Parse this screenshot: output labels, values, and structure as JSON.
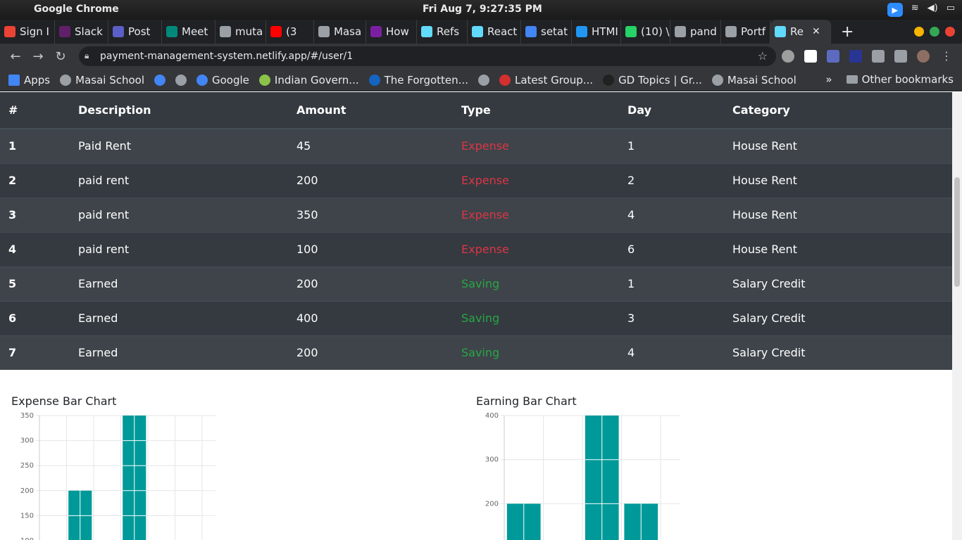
{
  "os_bar": {
    "app_name": "Google Chrome",
    "clock": "Fri Aug  7,  9:27:35 PM"
  },
  "tabs": [
    {
      "label": "Sign I",
      "color": "#ea4335"
    },
    {
      "label": "Slack",
      "color": "#611f69"
    },
    {
      "label": "Post",
      "color": "#5b5fc7"
    },
    {
      "label": "Meet",
      "color": "#00897b"
    },
    {
      "label": "muta",
      "color": "#9aa0a6"
    },
    {
      "label": "(3",
      "color": "#ff0000"
    },
    {
      "label": "Masa",
      "color": "#9aa0a6"
    },
    {
      "label": "How",
      "color": "#7b1fa2"
    },
    {
      "label": "Refs",
      "color": "#61dafb"
    },
    {
      "label": "React",
      "color": "#61dafb"
    },
    {
      "label": "setat",
      "color": "#4285f4"
    },
    {
      "label": "HTMI",
      "color": "#2196f3"
    },
    {
      "label": "(10) \\",
      "color": "#25d366"
    },
    {
      "label": "pand",
      "color": "#9aa0a6"
    },
    {
      "label": "Portf",
      "color": "#9aa0a6"
    },
    {
      "label": "Re",
      "color": "#61dafb",
      "active": true
    }
  ],
  "address_bar": {
    "url": "payment-management-system.netlify.app/#/user/1"
  },
  "bookmarks": [
    {
      "label": "Apps",
      "color": "#4285f4"
    },
    {
      "label": "Masai School",
      "color": "#9aa0a6"
    },
    {
      "label": "",
      "color": "#4285f4"
    },
    {
      "label": "",
      "color": "#9aa0a6"
    },
    {
      "label": "Google",
      "color": "#4285f4"
    },
    {
      "label": "Indian Govern...",
      "color": "#8bc34a"
    },
    {
      "label": "The Forgotten...",
      "color": "#1565c0"
    },
    {
      "label": "",
      "color": "#9aa0a6"
    },
    {
      "label": "Latest Group...",
      "color": "#d32f2f"
    },
    {
      "label": "GD Topics | Gr...",
      "color": "#212121"
    },
    {
      "label": "Masai School",
      "color": "#9aa0a6"
    }
  ],
  "bookmarks_more": "»",
  "other_bookmarks": "Other bookmarks",
  "table": {
    "headers": [
      "#",
      "Description",
      "Amount",
      "Type",
      "Day",
      "Category"
    ],
    "rows": [
      {
        "n": "1",
        "desc": "Paid Rent",
        "amount": "45",
        "type": "Expense",
        "day": "1",
        "category": "House Rent"
      },
      {
        "n": "2",
        "desc": "paid rent",
        "amount": "200",
        "type": "Expense",
        "day": "2",
        "category": "House Rent"
      },
      {
        "n": "3",
        "desc": "paid rent",
        "amount": "350",
        "type": "Expense",
        "day": "4",
        "category": "House Rent"
      },
      {
        "n": "4",
        "desc": "paid rent",
        "amount": "100",
        "type": "Expense",
        "day": "6",
        "category": "House Rent"
      },
      {
        "n": "5",
        "desc": "Earned",
        "amount": "200",
        "type": "Saving",
        "day": "1",
        "category": "Salary Credit"
      },
      {
        "n": "6",
        "desc": "Earned",
        "amount": "400",
        "type": "Saving",
        "day": "3",
        "category": "Salary Credit"
      },
      {
        "n": "7",
        "desc": "Earned",
        "amount": "200",
        "type": "Saving",
        "day": "4",
        "category": "Salary Credit"
      }
    ]
  },
  "chart_data": [
    {
      "type": "bar",
      "title": "Expense Bar Chart",
      "bar_color": "#009999",
      "ylim": [
        100,
        350
      ],
      "yticks": [
        350,
        300,
        250,
        200,
        150,
        100
      ],
      "slots": 6,
      "bars": [
        {
          "slot": 1,
          "value": 200
        },
        {
          "slot": 3,
          "value": 350
        }
      ]
    },
    {
      "type": "bar",
      "title": "Earning Bar Chart",
      "bar_color": "#009999",
      "ylim": [
        200,
        400
      ],
      "yticks": [
        400,
        300,
        200
      ],
      "slots": 4,
      "bars": [
        {
          "slot": 0,
          "value": 200
        },
        {
          "slot": 2,
          "value": 400
        },
        {
          "slot": 3,
          "value": 200
        }
      ]
    }
  ]
}
